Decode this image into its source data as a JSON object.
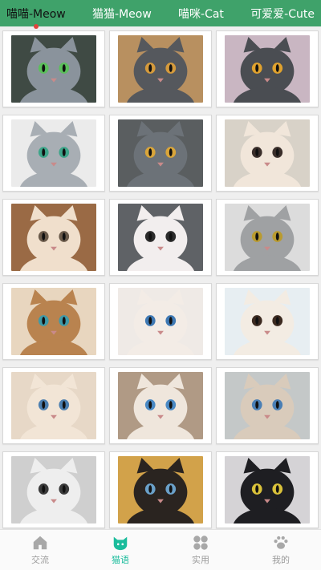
{
  "tabs": [
    {
      "label": "喵喵-Meow",
      "active": true
    },
    {
      "label": "猫猫-Meow",
      "active": false
    },
    {
      "label": "喵咪-Cat",
      "active": false
    },
    {
      "label": "可爱爱-Cute",
      "active": false
    }
  ],
  "colors": {
    "accent": "#3fa26a",
    "active_indicator": "#e0433c",
    "nav_active": "#1abc9c",
    "nav_inactive": "#9a9a9a"
  },
  "photos": [
    {
      "bg": "#3f4a44",
      "fur": "#8a939c",
      "eyes": "#5bbf5b",
      "icon": "gray-cat-photo"
    },
    {
      "bg": "#b89060",
      "fur": "#55585d",
      "eyes": "#d49a3c",
      "icon": "gray-cat-photo"
    },
    {
      "bg": "#c9b6c2",
      "fur": "#4a4d52",
      "eyes": "#e0a22e",
      "icon": "gray-cat-photo"
    },
    {
      "bg": "#ebebeb",
      "fur": "#a8aeb4",
      "eyes": "#3fa58a",
      "icon": "gray-cat-photo"
    },
    {
      "bg": "#5a5e60",
      "fur": "#6c7278",
      "eyes": "#d9a53a",
      "icon": "gray-cat-photo"
    },
    {
      "bg": "#d8d2c8",
      "fur": "#f1e6da",
      "eyes": "#3a2e2a",
      "icon": "calico-cat-photo"
    },
    {
      "bg": "#9a6a45",
      "fur": "#f0dfcc",
      "eyes": "#6a5a4a",
      "icon": "fluffy-cat-photo"
    },
    {
      "bg": "#5f6266",
      "fur": "#f2eeee",
      "eyes": "#2b2b2b",
      "icon": "white-cat-photo"
    },
    {
      "bg": "#dcdcdc",
      "fur": "#9fa1a3",
      "eyes": "#b99b2f",
      "icon": "tabby-cat-photo"
    },
    {
      "bg": "#e8d6bf",
      "fur": "#b9834f",
      "eyes": "#3f9aa8",
      "icon": "orange-cat-photo"
    },
    {
      "bg": "#efeae6",
      "fur": "#f3ece6",
      "eyes": "#3e78b3",
      "icon": "ragdoll-cat-photo"
    },
    {
      "bg": "#e7eef2",
      "fur": "#f3ece3",
      "eyes": "#3c2a20",
      "icon": "exotic-cat-photo"
    },
    {
      "bg": "#e7d8c7",
      "fur": "#f2e5d6",
      "eyes": "#4c7fb0",
      "icon": "ragdoll-cat-photo"
    },
    {
      "bg": "#b09a85",
      "fur": "#efe6dc",
      "eyes": "#4a89c4",
      "icon": "siamese-cat-photo"
    },
    {
      "bg": "#c4c8c8",
      "fur": "#d9cbbb",
      "eyes": "#4a7fb5",
      "icon": "siamese-cat-photo"
    },
    {
      "bg": "#cfcfcf",
      "fur": "#eeeeee",
      "eyes": "#3b3b3b",
      "icon": "white-cat-photo"
    },
    {
      "bg": "#d2a24a",
      "fur": "#2a2420",
      "eyes": "#6aa0c8",
      "icon": "siamese-cat-photo"
    },
    {
      "bg": "#d5d3d6",
      "fur": "#1e1e22",
      "eyes": "#d9c13a",
      "icon": "black-cat-photo"
    }
  ],
  "nav": [
    {
      "label": "交流",
      "icon": "home-icon",
      "active": false
    },
    {
      "label": "猫语",
      "icon": "cat-face-icon",
      "active": true
    },
    {
      "label": "实用",
      "icon": "grid-icon",
      "active": false
    },
    {
      "label": "我的",
      "icon": "paw-icon",
      "active": false
    }
  ]
}
